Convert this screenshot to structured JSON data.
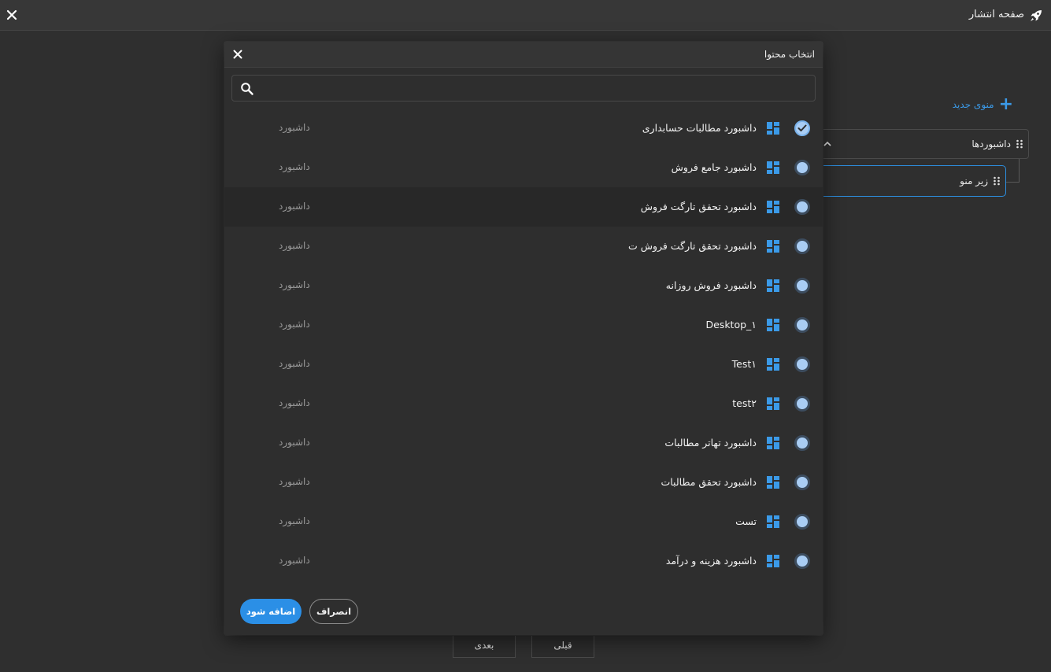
{
  "window": {
    "title": "صفحه انتشار"
  },
  "page": {
    "new_menu_label": "منوی جدید",
    "tree_root_label": "داشبوردها",
    "tree_child_label": "زیر منو",
    "next_label": "بعدی",
    "prev_label": "قبلی"
  },
  "modal": {
    "title": "انتخاب محتوا",
    "search_placeholder": "",
    "add_label": "اضافه شود",
    "cancel_label": "انصراف",
    "items": [
      {
        "title": "داشبورد مطالبات حسابداری",
        "type": "داشبورد",
        "checked": true
      },
      {
        "title": "داشبورد جامع فروش",
        "type": "داشبورد",
        "checked": false
      },
      {
        "title": "داشبورد تحقق تارگت فروش",
        "type": "داشبورد",
        "checked": false,
        "highlighted": true
      },
      {
        "title": "داشبورد تحقق تارگت فروش ت",
        "type": "داشبورد",
        "checked": false
      },
      {
        "title": "داشبورد فروش روزانه",
        "type": "داشبورد",
        "checked": false
      },
      {
        "title": "Desktop_۱",
        "type": "داشبورد",
        "checked": false
      },
      {
        "title": "Test۱",
        "type": "داشبورد",
        "checked": false
      },
      {
        "title": "test۲",
        "type": "داشبورد",
        "checked": false
      },
      {
        "title": "داشبورد تهاتر مطالبات",
        "type": "داشبورد",
        "checked": false
      },
      {
        "title": "داشبورد تحقق مطالبات",
        "type": "داشبورد",
        "checked": false
      },
      {
        "title": "تست",
        "type": "داشبورد",
        "checked": false
      },
      {
        "title": "داشبورد هزینه و درآمد",
        "type": "داشبورد",
        "checked": false
      }
    ]
  },
  "colors": {
    "accent": "#2b8fe6",
    "radio_fill": "#a9cdf4",
    "dashboard_icon": "#3b9ae8"
  }
}
